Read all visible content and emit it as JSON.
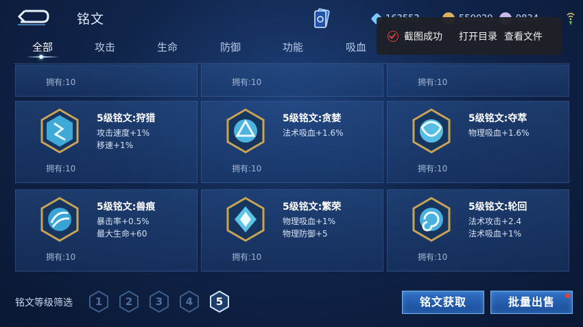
{
  "header": {
    "title": "铭文",
    "currencies": [
      "163553",
      "550029",
      "9834"
    ]
  },
  "toast": {
    "message": "截图成功",
    "open_dir": "打开目录",
    "view_file": "查看文件"
  },
  "tabs": [
    "全部",
    "攻击",
    "生命",
    "防御",
    "功能",
    "吸血"
  ],
  "cards_top_row": [
    {
      "owned": "拥有:10"
    },
    {
      "owned": "拥有:10"
    },
    {
      "owned": "拥有:10"
    }
  ],
  "cards": [
    {
      "name": "5级铭文:狩猎",
      "attrs": [
        "攻击速度+1%",
        "移速+1%"
      ],
      "owned": "拥有:10"
    },
    {
      "name": "5级铭文:贪婪",
      "attrs": [
        "法术吸血+1.6%"
      ],
      "owned": "拥有:10"
    },
    {
      "name": "5级铭文:夺萃",
      "attrs": [
        "物理吸血+1.6%"
      ],
      "owned": "拥有:10"
    },
    {
      "name": "5级铭文:兽痕",
      "attrs": [
        "暴击率+0.5%",
        "最大生命+60"
      ],
      "owned": "拥有:10"
    },
    {
      "name": "5级铭文:繁荣",
      "attrs": [
        "物理吸血+1%",
        "物理防御+5"
      ],
      "owned": "拥有:10"
    },
    {
      "name": "5级铭文:轮回",
      "attrs": [
        "法术攻击+2.4",
        "法术吸血+1%"
      ],
      "owned": "拥有:10"
    }
  ],
  "filter": {
    "label": "铭文等级筛选",
    "levels": [
      "1",
      "2",
      "3",
      "4",
      "5"
    ],
    "selected": "5"
  },
  "buttons": {
    "obtain": "铭文获取",
    "bulk_sell": "批量出售"
  },
  "colors": {
    "accent": "#2f6fc4",
    "text_owned": "#9fb5d3",
    "notify": "#e8403a"
  }
}
